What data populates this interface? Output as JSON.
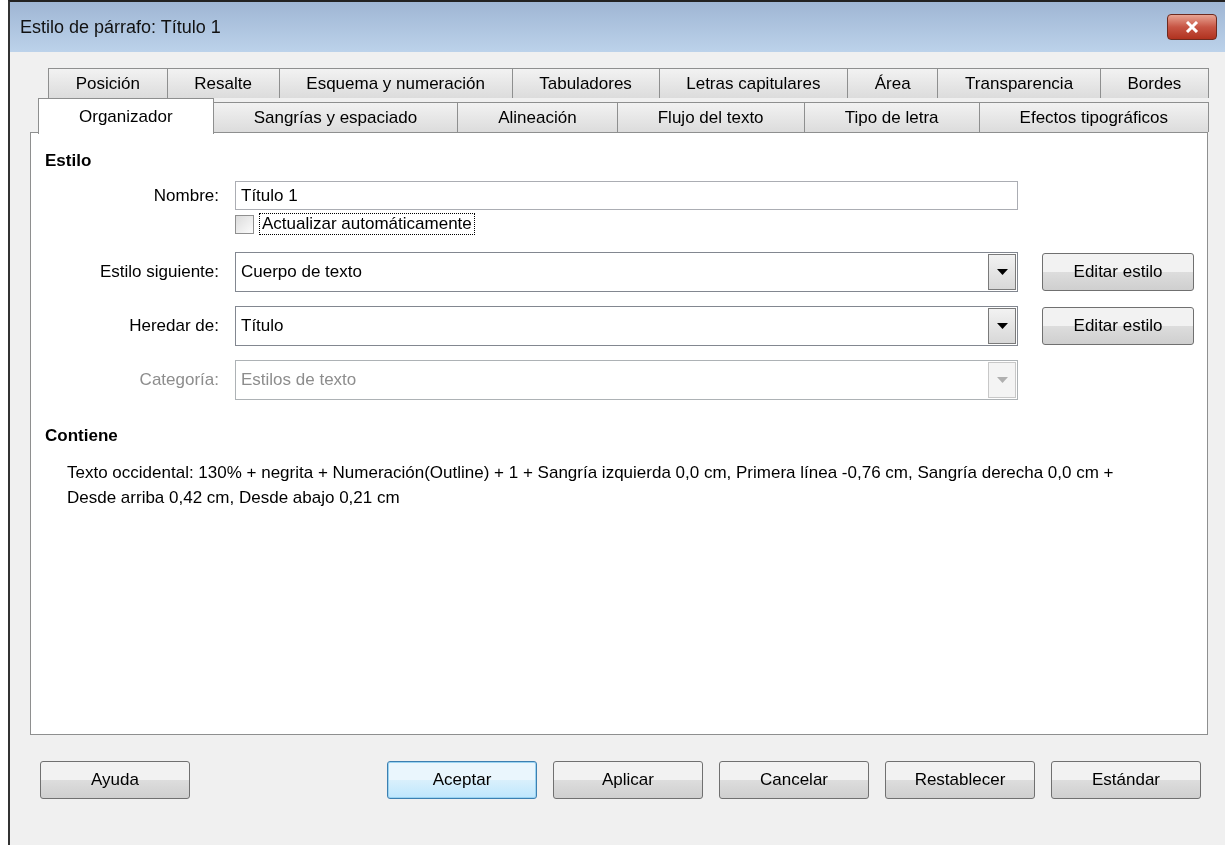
{
  "window": {
    "title": "Estilo de párrafo: Título 1"
  },
  "tab_rows": [
    {
      "tabs": [
        {
          "label": "Posición",
          "selected": false
        },
        {
          "label": "Resalte",
          "selected": false
        },
        {
          "label": "Esquema y numeración",
          "selected": false
        },
        {
          "label": "Tabuladores",
          "selected": false
        },
        {
          "label": "Letras capitulares",
          "selected": false
        },
        {
          "label": "Área",
          "selected": false
        },
        {
          "label": "Transparencia",
          "selected": false
        },
        {
          "label": "Bordes",
          "selected": false
        }
      ]
    },
    {
      "tabs": [
        {
          "label": "Organizador",
          "selected": true
        },
        {
          "label": "Sangrías y espaciado",
          "selected": false
        },
        {
          "label": "Alineación",
          "selected": false
        },
        {
          "label": "Flujo del texto",
          "selected": false
        },
        {
          "label": "Tipo de letra",
          "selected": false
        },
        {
          "label": "Efectos tipográficos",
          "selected": false
        }
      ]
    }
  ],
  "style_section": {
    "heading": "Estilo",
    "fields": [
      {
        "kind": "text",
        "label": "Nombre:",
        "value": "Título 1",
        "disabled": false
      },
      {
        "kind": "checkbox",
        "label": "Actualizar automáticamente",
        "checked": false,
        "focused": true
      },
      {
        "kind": "dropdown",
        "label": "Estilo siguiente:",
        "value": "Cuerpo de texto",
        "disabled": false,
        "button": "Editar estilo"
      },
      {
        "kind": "dropdown",
        "label": "Heredar de:",
        "value": "Título",
        "disabled": false,
        "button": "Editar estilo"
      },
      {
        "kind": "dropdown",
        "label": "Categoría:",
        "value": "Estilos de texto",
        "disabled": true
      }
    ]
  },
  "contains_section": {
    "heading": "Contiene",
    "description": "Texto occidental: 130% + negrita + Numeración(Outline) + 1 + Sangría izquierda 0,0 cm, Primera línea -0,76 cm, Sangría derecha 0,0 cm + Desde arriba 0,42 cm, Desde abajo 0,21 cm"
  },
  "buttons": [
    {
      "label": "Ayuda",
      "default": false
    },
    {
      "label": "Aceptar",
      "default": true
    },
    {
      "label": "Aplicar",
      "default": false
    },
    {
      "label": "Cancelar",
      "default": false
    },
    {
      "label": "Restablecer",
      "default": false
    },
    {
      "label": "Estándar",
      "default": false
    }
  ]
}
